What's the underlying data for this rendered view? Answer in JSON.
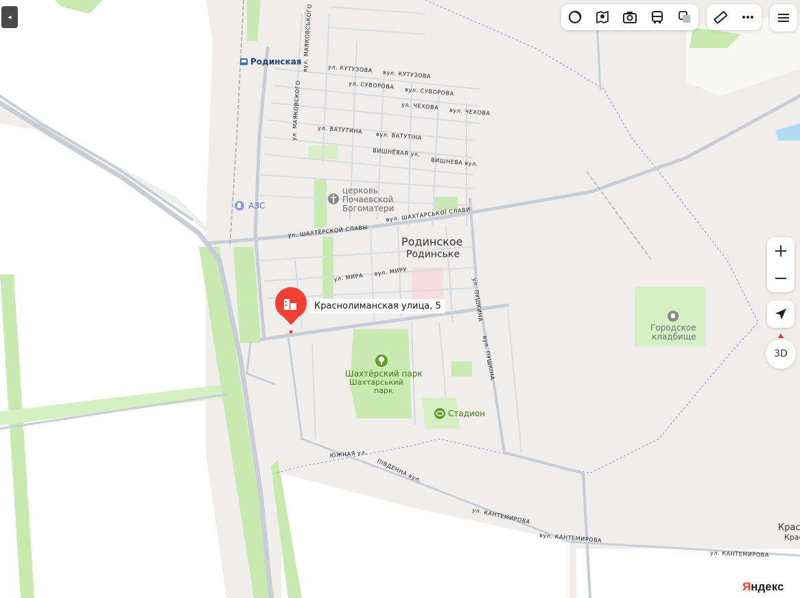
{
  "toolbar": {
    "layers": [
      "traffic-circle-icon",
      "map-book-icon",
      "camera-icon",
      "bus-icon",
      "layers-icon"
    ],
    "tools": [
      "ruler-icon",
      "more-icon"
    ],
    "menu": "menu-icon"
  },
  "controls": {
    "zoom_in": "+",
    "zoom_out": "−",
    "geolocation": "navigation-arrow-icon",
    "view_3d": "3D"
  },
  "place": {
    "name_ru": "Родинское",
    "name_uk": "Родинське"
  },
  "marker": {
    "label": "Краснолиманская улица, 5",
    "color": "#f33f33"
  },
  "pois": {
    "station": "Родинская",
    "gas_station": "АЗС",
    "church_1": "церковь",
    "church_2": "Почаевской",
    "church_3": "Богоматери",
    "park_ru": "Шахтёрский парк",
    "park_uk_1": "Шахтарський",
    "park_uk_2": "парк",
    "stadium": "Стадион",
    "cemetery_1": "Городское",
    "cemetery_2": "кладбище",
    "edge_1": "Красн",
    "edge_2": "Крас"
  },
  "streets": {
    "kutuzova_uk": "ул. КУТУЗОВА",
    "kutuzova_ru": "вул. КУТУЗОВА",
    "suvorova_uk": "ул. СУВОРОВА",
    "suvorova_ru": "вул. СУВОРОВА",
    "chekhova_uk": "ул. ЧЕХОВА",
    "chekhova_ru": "вул. ЧЕХОВА",
    "vatutina_uk": "ул. ВАТУТИНА",
    "vatutina_ru": "вул. ВАТУТІНА",
    "vishnevaya": "ВИШНЁВАЯ ул.",
    "vyshneva": "ВИШНЕВА вул.",
    "shakhtar_ru": "ул. ШАХТЁРСКОЙ СЛАВЫ",
    "shakhtar_uk": "вул. ШАХТАРСЬКОЇ СЛАВИ",
    "mira_ru": "ул. МИРА",
    "mira_uk": "вул. МИРУ",
    "pushkina_ru": "ул. ПУШКИНА",
    "pushkina_uk": "вул. ПУШКІНА",
    "mayak_uk": "вул. МАЯКОВСЬКОГО",
    "mayak_ru": "ул. МАЯКОВСКОГО",
    "yuzhnaya": "ЮЖНАЯ ул.",
    "pivdenna": "ПІВДЕННА вул.",
    "kantemirova_1": "ул. КАНТЕМИРОВА",
    "kantemirova_2": "вул. КАНТЕМИРОВА",
    "kantemirova_3": "ул. КАНТЕМИРОВА"
  },
  "brand": {
    "first": "Я",
    "rest": "ндекс"
  },
  "colors": {
    "land": "#efeeec",
    "field": "#ffffff",
    "green": "#c8e9b0",
    "road": "#c9ced6",
    "boundary": "#8c8ee8"
  }
}
